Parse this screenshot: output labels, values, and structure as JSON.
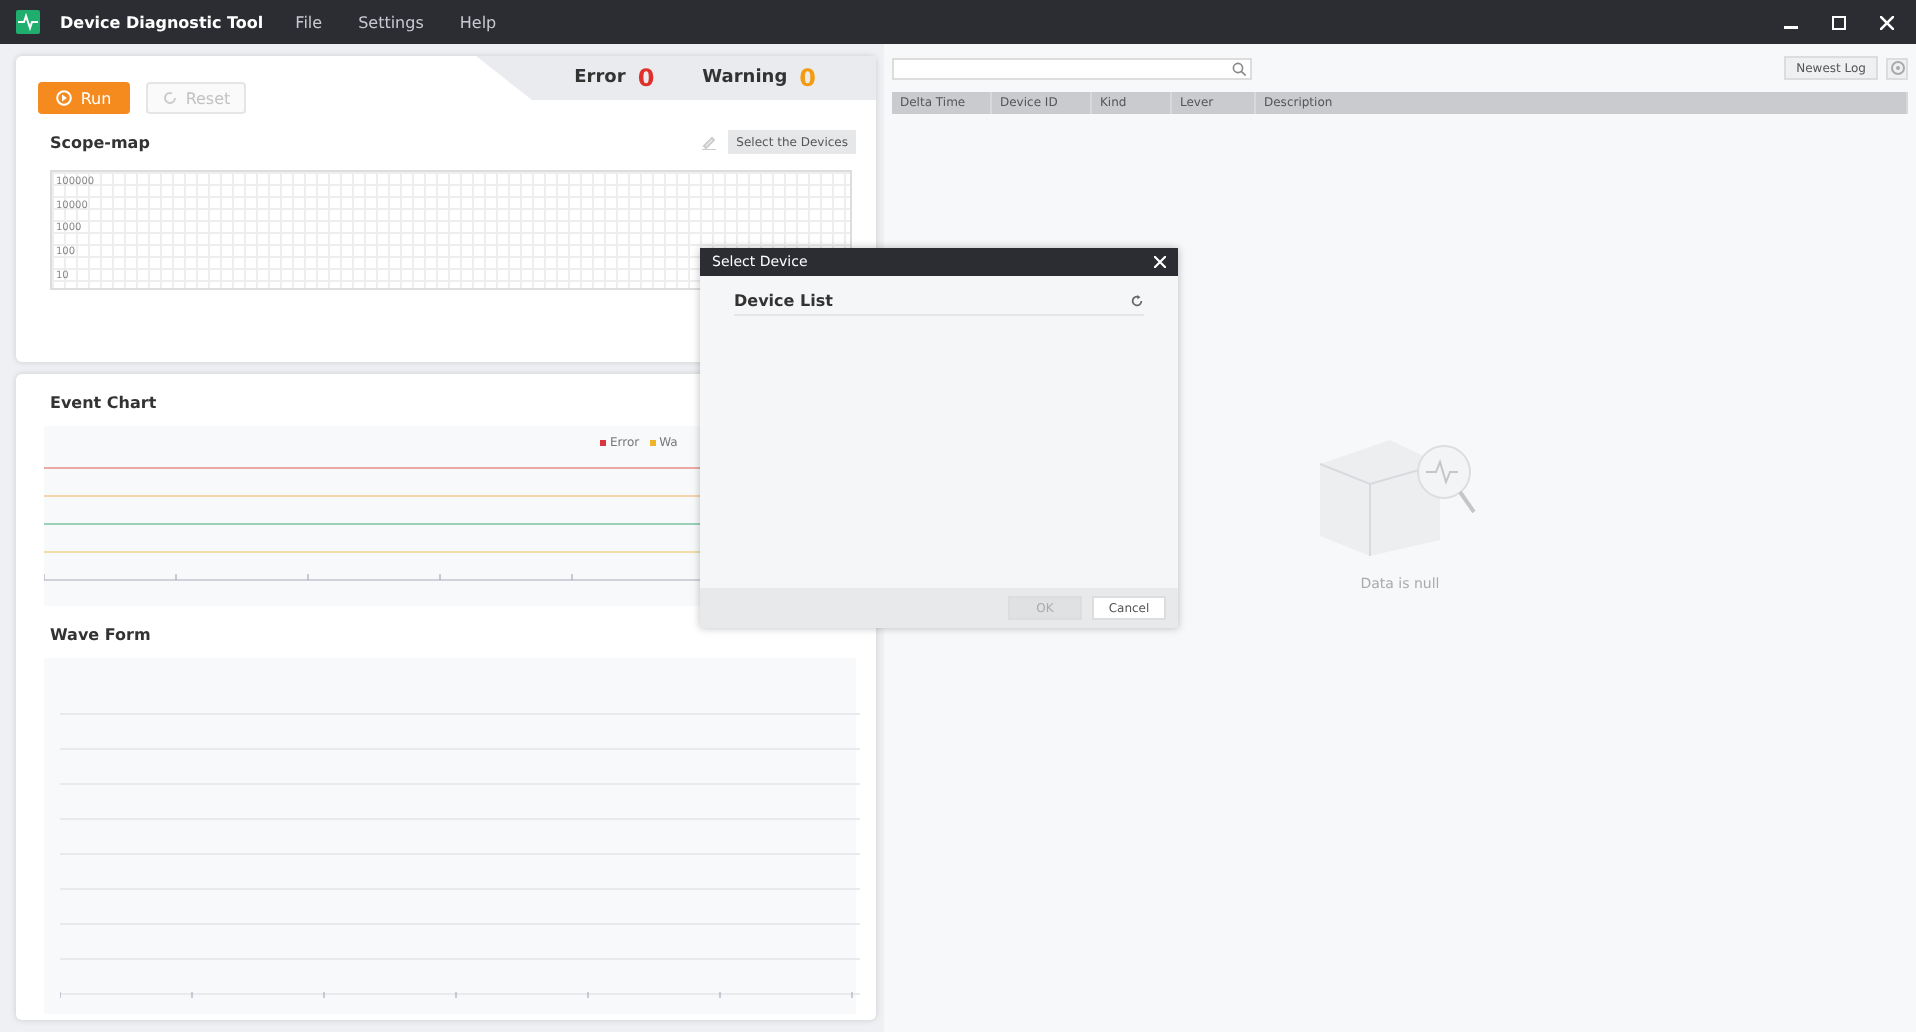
{
  "window": {
    "title": "Device Diagnostic Tool"
  },
  "menu": [
    "File",
    "Settings",
    "Help"
  ],
  "toolbar": {
    "run": {
      "label": "Run",
      "disabled": false
    },
    "reset": {
      "label": "Reset",
      "disabled": true
    }
  },
  "status": [
    {
      "label": "Error",
      "count": "0",
      "color": "#e0302a"
    },
    {
      "label": "Warning",
      "count": "0",
      "color": "#f39c12"
    }
  ],
  "scope_map": {
    "title": "Scope-map",
    "button": "Select the Devices",
    "y_labels": [
      "100000",
      "10000",
      "1000",
      "100",
      "10"
    ]
  },
  "event_chart": {
    "title": "Event Chart",
    "legend": [
      {
        "label": "Error",
        "color": "#d9363e"
      },
      {
        "label": "Wa",
        "color": "#f0b429"
      }
    ]
  },
  "wave_form": {
    "title": "Wave Form"
  },
  "log": {
    "button": "Newest Log",
    "columns": [
      "Delta Time",
      "Device ID",
      "Kind",
      "Lever",
      "Description"
    ],
    "empty_text": "Data is null"
  },
  "dialog": {
    "title": "Select Device",
    "list_title": "Device List",
    "buttons": [
      {
        "label": "OK",
        "disabled": true
      },
      {
        "label": "Cancel",
        "disabled": false
      }
    ]
  }
}
